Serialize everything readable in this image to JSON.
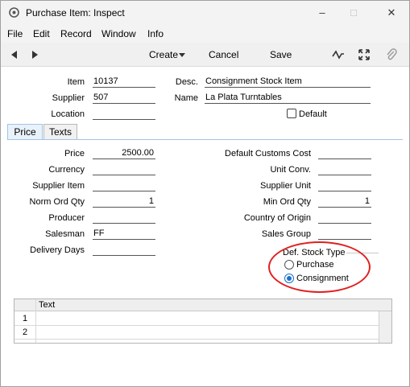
{
  "window": {
    "title": "Purchase Item: Inspect"
  },
  "menu": [
    "File",
    "Edit",
    "Record",
    "Window",
    "Info"
  ],
  "toolbar": {
    "create_label": "Create",
    "cancel_label": "Cancel",
    "save_label": "Save"
  },
  "header": {
    "item_label": "Item",
    "item_value": "10137",
    "desc_label": "Desc.",
    "desc_value": "Consignment Stock Item",
    "supplier_label": "Supplier",
    "supplier_value": "507",
    "name_label": "Name",
    "name_value": "La Plata Turntables",
    "location_label": "Location",
    "location_value": "",
    "default_label": "Default"
  },
  "tabs": [
    {
      "label": "Price"
    },
    {
      "label": "Texts"
    }
  ],
  "price_tab": {
    "left": [
      {
        "label": "Price",
        "value": "2500.00"
      },
      {
        "label": "Currency",
        "value": ""
      },
      {
        "label": "Supplier Item",
        "value": ""
      },
      {
        "label": "Norm Ord Qty",
        "value": "1"
      },
      {
        "label": "Producer",
        "value": ""
      },
      {
        "label": "Salesman",
        "value": "FF"
      },
      {
        "label": "Delivery Days",
        "value": ""
      }
    ],
    "right": [
      {
        "label": "Default Customs Cost",
        "value": ""
      },
      {
        "label": "Unit Conv.",
        "value": ""
      },
      {
        "label": "Supplier Unit",
        "value": ""
      },
      {
        "label": "Min Ord Qty",
        "value": "1"
      },
      {
        "label": "Country of Origin",
        "value": ""
      },
      {
        "label": "Sales Group",
        "value": ""
      }
    ],
    "stock_type": {
      "title": "Def. Stock Type",
      "options": [
        {
          "label": "Purchase",
          "selected": false
        },
        {
          "label": "Consignment",
          "selected": true
        }
      ]
    }
  },
  "matrix": {
    "column_header": "Text",
    "rows": [
      "1",
      "2"
    ]
  },
  "colors": {
    "accent": "#1a6fc9",
    "highlight_ellipse": "#e02020",
    "tab_active": "#e9f2fb"
  }
}
